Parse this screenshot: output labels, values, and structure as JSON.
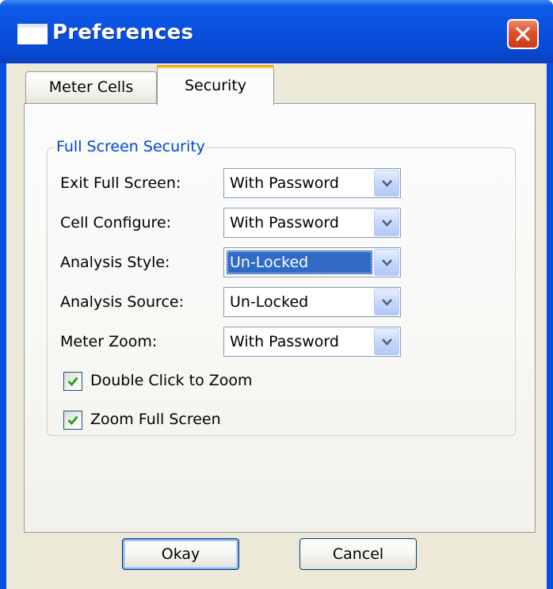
{
  "window": {
    "title": "Preferences",
    "icon": "window-icon",
    "close_icon": "close-icon"
  },
  "tabs": [
    {
      "label": "Meter Cells",
      "active": false
    },
    {
      "label": "Security",
      "active": true
    }
  ],
  "group": {
    "legend": "Full Screen Security",
    "fields": [
      {
        "label": "Exit Full Screen:",
        "value": "With Password",
        "highlighted": false
      },
      {
        "label": "Cell Configure:",
        "value": "With Password",
        "highlighted": false
      },
      {
        "label": "Analysis Style:",
        "value": "Un-Locked",
        "highlighted": true
      },
      {
        "label": "Analysis Source:",
        "value": "Un-Locked",
        "highlighted": false
      },
      {
        "label": "Meter Zoom:",
        "value": "With Password",
        "highlighted": false
      }
    ],
    "checkboxes": [
      {
        "label": "Double Click to Zoom",
        "checked": true
      },
      {
        "label": "Zoom Full Screen",
        "checked": true
      }
    ]
  },
  "buttons": {
    "okay": "Okay",
    "cancel": "Cancel"
  },
  "colors": {
    "titlebar": "#0a50e0",
    "dialog_face": "#ece9d8",
    "selection": "#316ac5",
    "legend_text": "#0046d5",
    "check_mark": "#21a121"
  }
}
